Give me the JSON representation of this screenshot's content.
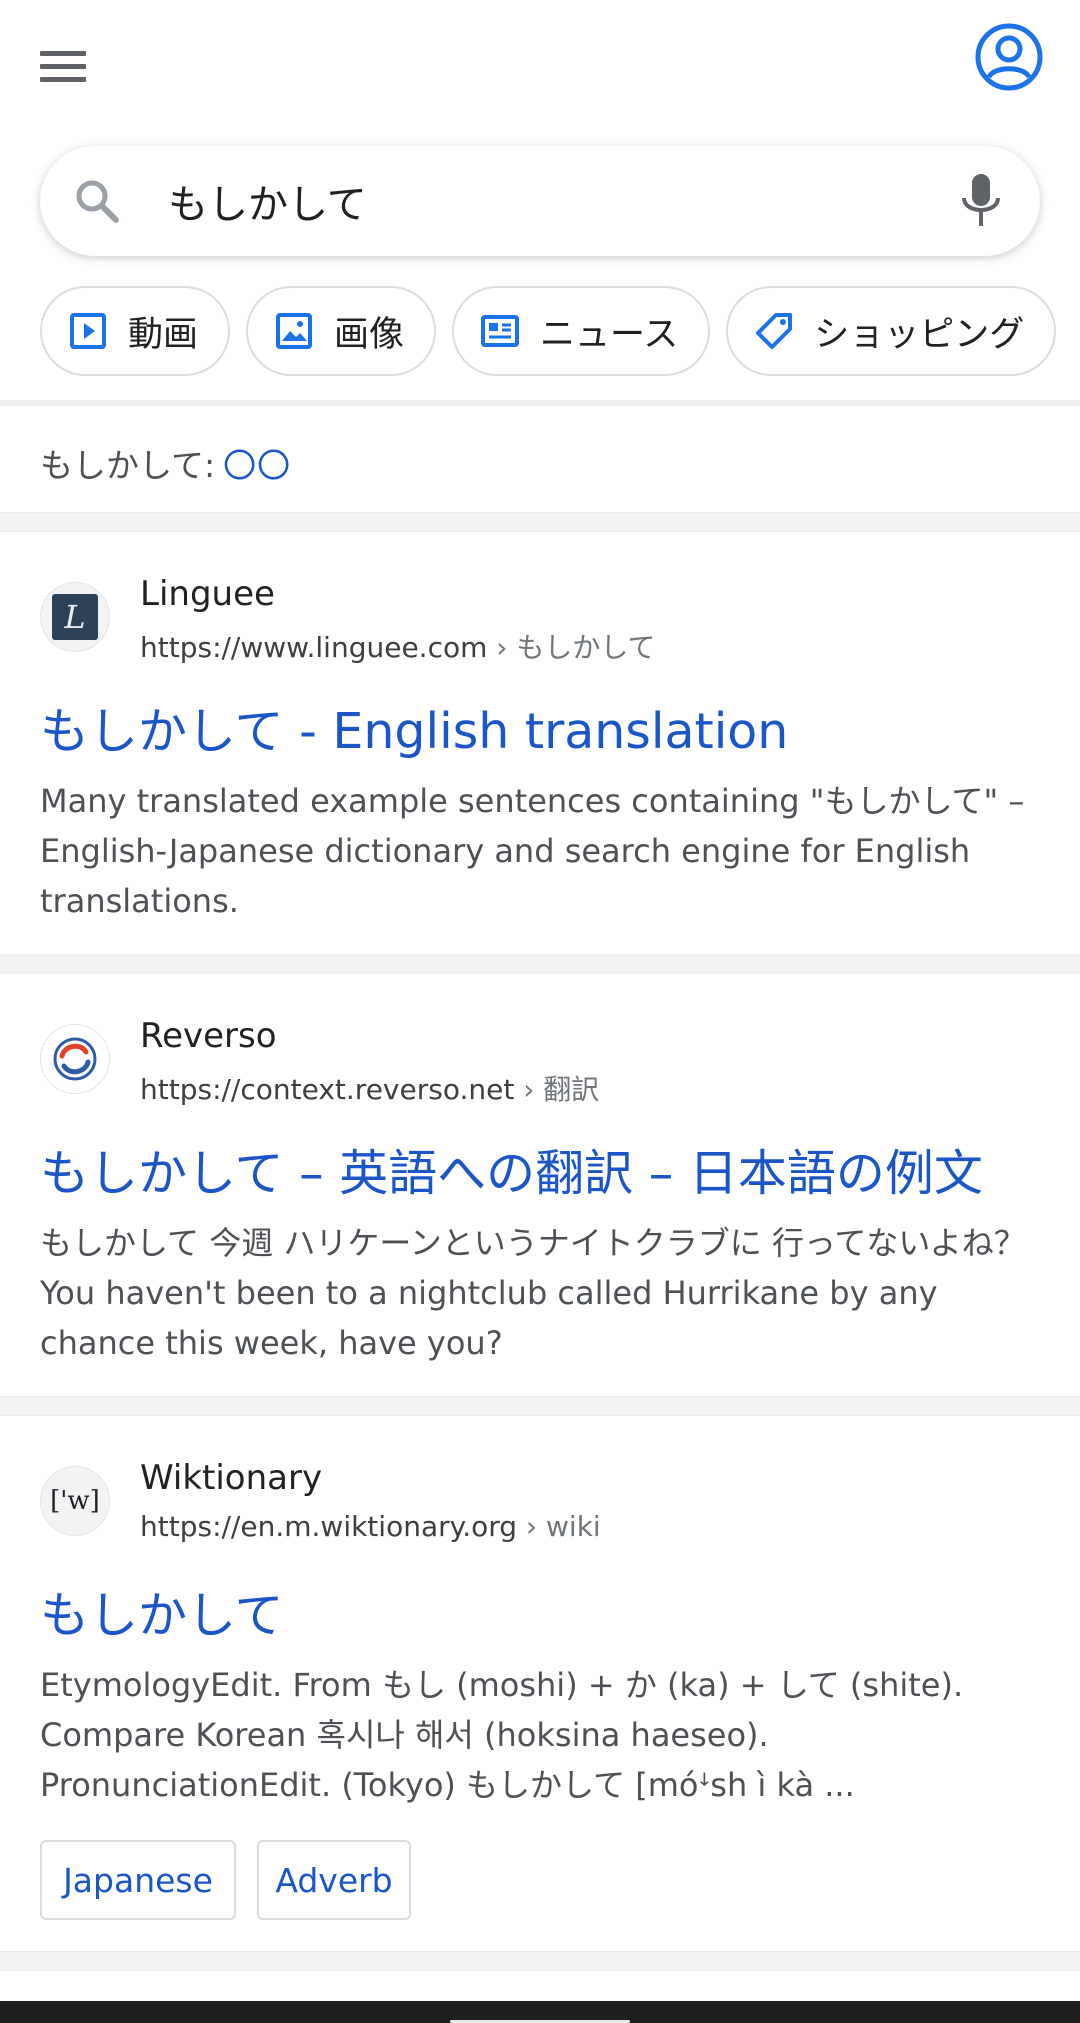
{
  "search": {
    "query": "もしかして",
    "placeholder": ""
  },
  "chips": [
    {
      "label": "動画",
      "icon": "video-icon"
    },
    {
      "label": "画像",
      "icon": "image-icon"
    },
    {
      "label": "ニュース",
      "icon": "news-icon"
    },
    {
      "label": "ショッピング",
      "icon": "tag-icon"
    }
  ],
  "did_you_mean": {
    "prefix": "もしかして:",
    "suggestion": "〇〇"
  },
  "results": [
    {
      "site_name": "Linguee",
      "url": "https://www.linguee.com",
      "crumb": " › もしかして",
      "favicon": "linguee-logo",
      "favicon_text": "L",
      "title": "もしかして - English translation",
      "snippet": "Many translated example sentences containing \"もしかして\" – English-Japanese dictionary and search engine for English translations."
    },
    {
      "site_name": "Reverso",
      "url": "https://context.reverso.net",
      "crumb": " › 翻訳",
      "favicon": "reverso-logo",
      "title": "もしかして – 英語への翻訳 – 日本語の例文",
      "snippet": "もしかして 今週 ハリケーンというナイトクラブに 行ってないよね？ You haven't been to a nightclub called Hurrikane by any chance this week, have you?"
    },
    {
      "site_name": "Wiktionary",
      "url": "https://en.m.wiktionary.org",
      "crumb": " › wiki",
      "favicon": "wiktionary-logo",
      "favicon_text": "['w]",
      "title": "もしかして",
      "snippet": "EtymologyEdit. From もし (moshi) + か (ka) + して (shite). Compare Korean 혹시나 해서 (hoksina haeseo). PronunciationEdit. (Tokyo) もしかして [móꜜsh ì kà ...",
      "tags": [
        "Japanese",
        "Adverb"
      ]
    }
  ],
  "colors": {
    "link": "#1a56c7",
    "accent_blue": "#1a73e8",
    "text": "#202124",
    "snippet": "#4d5156",
    "separator": "#f1f3f4"
  }
}
